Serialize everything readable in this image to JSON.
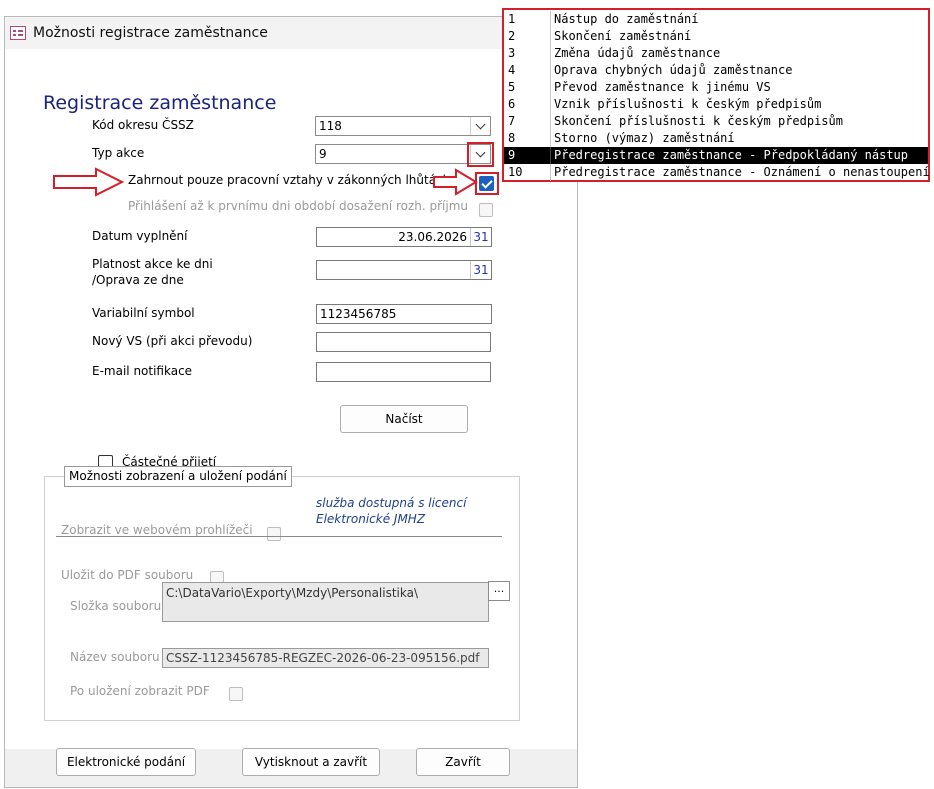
{
  "window": {
    "title": "Možnosti registrace zaměstnance"
  },
  "form": {
    "heading": "Registrace zaměstnance",
    "district": {
      "label": "Kód okresu ČSSZ",
      "value": "118"
    },
    "action_type": {
      "label": "Typ akce",
      "value": "9"
    },
    "only_legal": {
      "label": "Zahrnout pouze pracovní vztahy v zákonných lhůtách",
      "checked": true
    },
    "first_day": {
      "label": "Přihlášení až k prvnímu dni období dosažení rozh. příjmu",
      "checked": false,
      "disabled": true
    },
    "date_filled": {
      "label": "Datum vyplnění",
      "value": "23.06.2026",
      "calendar": "31"
    },
    "valid_from": {
      "label_line1": "Platnost akce ke dni",
      "label_line2": "/Oprava ze dne",
      "value": "",
      "calendar": "31"
    },
    "var_symbol": {
      "label": "Variabilní symbol",
      "value": "1123456785"
    },
    "new_vs": {
      "label": "Nový VS (při akci převodu)",
      "value": ""
    },
    "email": {
      "label": "E-mail notifikace",
      "value": ""
    },
    "load_button": "Načíst",
    "partial": {
      "label": "Částečné přijetí",
      "checked": false
    }
  },
  "output_group": {
    "legend": "Možnosti zobrazení a uložení podání",
    "browser": {
      "label": "Zobrazit ve webovém prohlížeči",
      "checked": false
    },
    "note_line1": "služba dostupná s licencí",
    "note_line2": "Elektronické JMHZ",
    "save_pdf": {
      "label": "Uložit do PDF souboru",
      "checked": false
    },
    "folder": {
      "label": "Složka souboru",
      "value": "C:\\DataVario\\Exporty\\Mzdy\\Personalistika\\",
      "browse": "..."
    },
    "filename": {
      "label": "Název souboru",
      "value": "CSSZ-1123456785-REGZEC-2026-06-23-095156.pdf"
    },
    "show_after": {
      "label": "Po uložení zobrazit PDF",
      "checked": false
    }
  },
  "footer": {
    "electronic": "Elektronické podání",
    "print_close": "Vytisknout a zavřít",
    "close": "Zavřít"
  },
  "dropdown_list": {
    "selected": "9",
    "items": [
      {
        "code": "1",
        "text": "Nástup do zaměstnání"
      },
      {
        "code": "2",
        "text": "Skončení zaměstnání"
      },
      {
        "code": "3",
        "text": "Změna údajů zaměstnance"
      },
      {
        "code": "4",
        "text": "Oprava chybných údajů zaměstnance"
      },
      {
        "code": "5",
        "text": "Převod zaměstnance k jinému VS"
      },
      {
        "code": "6",
        "text": "Vznik příslušnosti k českým předpisům"
      },
      {
        "code": "7",
        "text": "Skončení příslušnosti k českým předpisům"
      },
      {
        "code": "8",
        "text": "Storno (výmaz) zaměstnání"
      },
      {
        "code": "9",
        "text": "Předregistrace zaměstnance - Předpokládaný nástup"
      },
      {
        "code": "10",
        "text": "Předregistrace zaměstnance - Oznámení o nenastoupení"
      }
    ]
  },
  "colors": {
    "heading": "#1a237e",
    "annotation": "#d41e2a",
    "checkbox_on": "#1f5fbf",
    "note": "#1f3f8f"
  }
}
